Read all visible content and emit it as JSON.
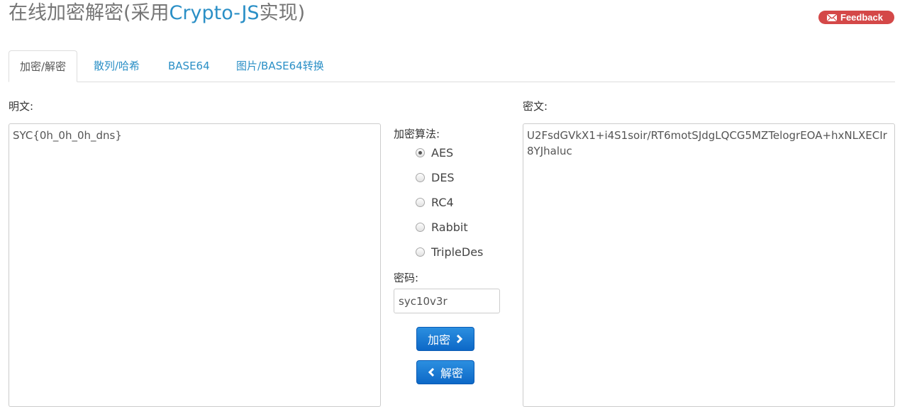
{
  "header": {
    "title_prefix": "在线加密解密(采用",
    "title_link": "Crypto-JS",
    "title_suffix": "实现)",
    "feedback_label": "Feedback"
  },
  "tabs": [
    {
      "label": "加密/解密",
      "active": true
    },
    {
      "label": "散列/哈希",
      "active": false
    },
    {
      "label": "BASE64",
      "active": false
    },
    {
      "label": "图片/BASE64转换",
      "active": false
    }
  ],
  "plaintext": {
    "label": "明文:",
    "value": "SYC{0h_0h_0h_dns}"
  },
  "ciphertext": {
    "label": "密文:",
    "value": "U2FsdGVkX1+i4S1soir/RT6motSJdgLQCG5MZTelogrEOA+hxNLXECIr8YJhaluc"
  },
  "algorithm": {
    "label": "加密算法:",
    "options": [
      "AES",
      "DES",
      "RC4",
      "Rabbit",
      "TripleDes"
    ],
    "selected": "AES"
  },
  "password": {
    "label": "密码:",
    "value": "syc10v3r"
  },
  "actions": {
    "encrypt_label": "加密",
    "decrypt_label": "解密"
  },
  "colors": {
    "link": "#2a8fc6",
    "feedback_bg": "#d44848",
    "button_bg": "#0d68c7"
  }
}
